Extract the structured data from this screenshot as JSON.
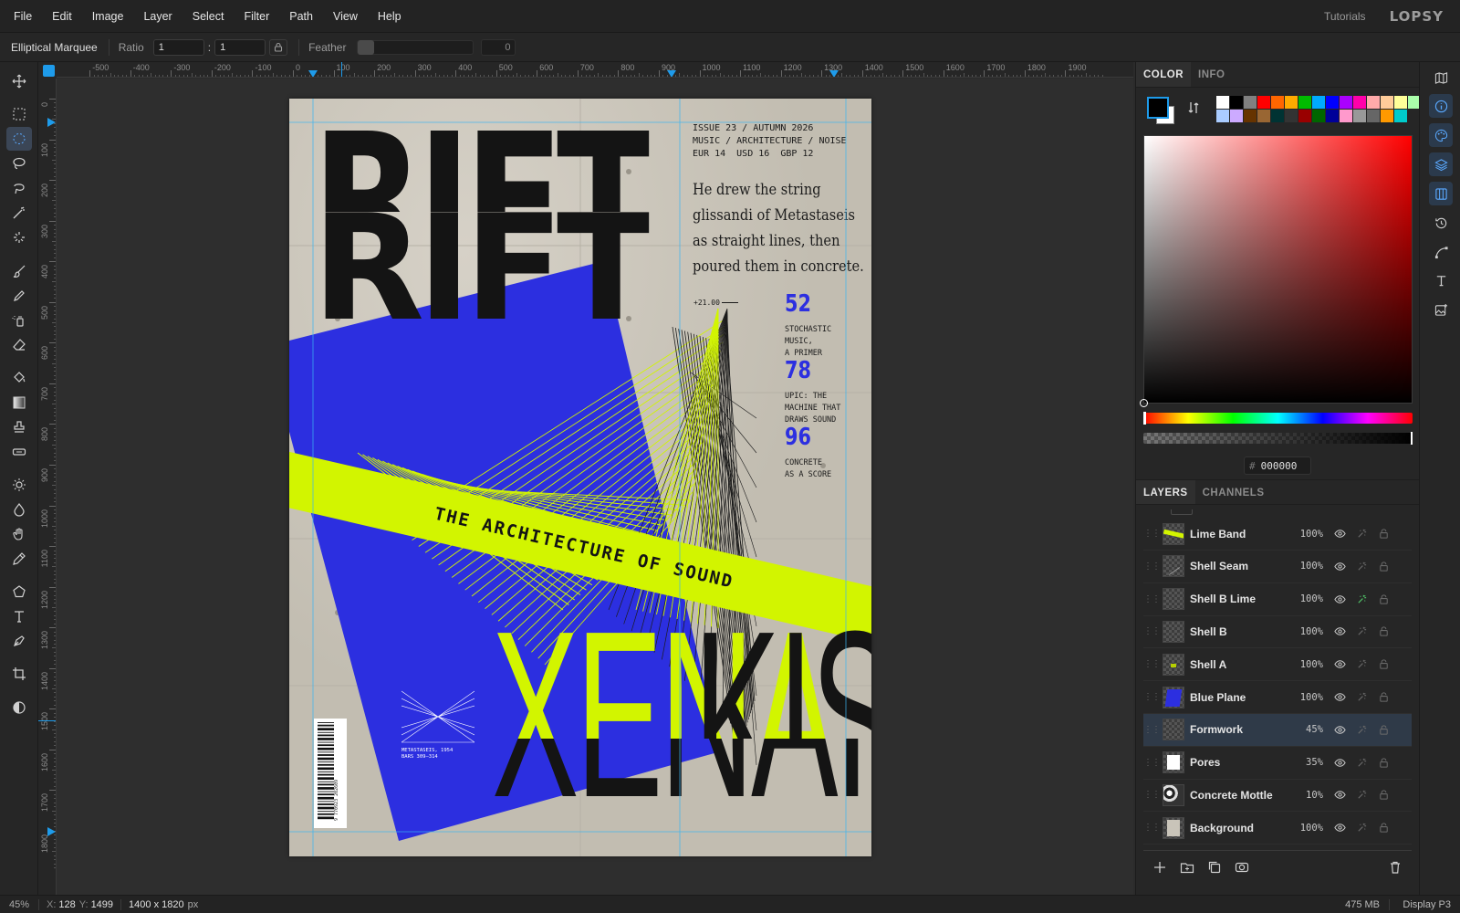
{
  "menu": [
    "File",
    "Edit",
    "Image",
    "Layer",
    "Select",
    "Filter",
    "Path",
    "View",
    "Help"
  ],
  "header": {
    "tutorials": "Tutorials",
    "logo": "LOPSY"
  },
  "options": {
    "tool_name": "Elliptical Marquee",
    "ratio_label": "Ratio",
    "ratio_w": "1",
    "ratio_sep": ":",
    "ratio_h": "1",
    "feather_label": "Feather",
    "feather_value": "0"
  },
  "ruler_top": [
    "-500",
    "-400",
    "-300",
    "-200",
    "-100",
    "0",
    "100",
    "200",
    "300",
    "400",
    "500",
    "600",
    "700",
    "800",
    "900",
    "1000",
    "1100",
    "1200",
    "1300",
    "1400",
    "1500",
    "1600",
    "1700",
    "1800",
    "1900"
  ],
  "ruler_left": [
    "0",
    "100",
    "200",
    "300",
    "400",
    "500",
    "600",
    "700",
    "800",
    "900",
    "1000",
    "1100",
    "1200",
    "1300",
    "1400",
    "1500",
    "1600",
    "1700",
    "1800"
  ],
  "tools": [
    "move-tool",
    "rect-marquee-tool",
    "elliptical-marquee-tool",
    "lasso-tool",
    "magnetic-lasso-tool",
    "magic-wand-tool",
    "quick-select-tool",
    "brush-tool",
    "pencil-tool",
    "spray-tool",
    "eraser-tool",
    "paint-bucket-tool",
    "gradient-tool",
    "clone-stamp-tool",
    "healing-tool",
    "dodge-tool",
    "burn-tool",
    "hand-tool",
    "eyedropper-tool",
    "shape-tool",
    "type-tool",
    "pen-tool",
    "crop-tool",
    "mask-mode-tool"
  ],
  "active_tool": "elliptical-marquee-tool",
  "artwork": {
    "issue_line1": "ISSUE 23 / AUTUMN 2026",
    "issue_line2": "MUSIC / ARCHITECTURE / NOISE",
    "issue_line3": "EUR 14  USD 16  GBP 12",
    "title_top": "RIFT",
    "title_bottom": "RIFT",
    "quote_l1": "He drew the string",
    "quote_l2": "glissandi of Metastaseis",
    "quote_l3": "as straight lines, then",
    "quote_l4": "poured them in concrete.",
    "coord_note": "+21.00",
    "contents": [
      {
        "page": "52",
        "line1": "STOCHASTIC",
        "line2": "MUSIC,",
        "line3": "A PRIMER"
      },
      {
        "page": "78",
        "line1": "UPIC: THE",
        "line2": "MACHINE THAT",
        "line3": "DRAWS SOUND"
      },
      {
        "page": "96",
        "line1": "CONCRETE",
        "line2": "AS A SCORE",
        "line3": ""
      }
    ],
    "band_text": "THE ARCHITECTURE OF SOUND",
    "name_lime": "XENA",
    "name_dark": "KIS",
    "name_shadow": "XENAKIS",
    "caption_l1": "METASTASEIS, 1954",
    "caption_l2": "BARS 309–314",
    "barcode": "9 770923 202609"
  },
  "colors": {
    "accent": "#1e9bea",
    "blue_plane": "#2c2fe0",
    "lime": "#d2f500",
    "concrete": "#c9c4b9",
    "ink": "#141414",
    "foreground": "#000000",
    "background": "#ffffff"
  },
  "color_panel": {
    "tabs": [
      "COLOR",
      "INFO"
    ],
    "hex_label": "#",
    "hex_value": "000000",
    "palette_row1": [
      "#ffffff",
      "#000000",
      "#808080",
      "#ff0000",
      "#ff6600",
      "#ffaa00",
      "#00bb00",
      "#00aaff",
      "#0000ff",
      "#aa00ff",
      "#ff00aa",
      "#ffaaaa",
      "#ffcc99",
      "#ffff99",
      "#aaffaa"
    ],
    "palette_row2": [
      "#aaccff",
      "#ccaaff",
      "#663300",
      "#996633",
      "#003333",
      "#333333",
      "#990000",
      "#006600",
      "#000099",
      "#ff99cc",
      "#999999",
      "#666666",
      "#ff9900",
      "#00cccc"
    ]
  },
  "layers_panel": {
    "tabs": [
      "LAYERS",
      "CHANNELS"
    ],
    "layers": [
      {
        "name": "Lime Band",
        "opacity": "100%",
        "fx_on": false
      },
      {
        "name": "Shell Seam",
        "opacity": "100%",
        "fx_on": false
      },
      {
        "name": "Shell B Lime",
        "opacity": "100%",
        "fx_on": true
      },
      {
        "name": "Shell B",
        "opacity": "100%",
        "fx_on": false
      },
      {
        "name": "Shell A",
        "opacity": "100%",
        "fx_on": false
      },
      {
        "name": "Blue Plane",
        "opacity": "100%",
        "fx_on": false
      },
      {
        "name": "Formwork",
        "opacity": "45%",
        "fx_on": false
      },
      {
        "name": "Pores",
        "opacity": "35%",
        "fx_on": false
      },
      {
        "name": "Concrete Mottle",
        "opacity": "10%",
        "fx_on": false
      },
      {
        "name": "Background",
        "opacity": "100%",
        "fx_on": false
      }
    ],
    "selected": "Formwork"
  },
  "side_icons": [
    "map-icon",
    "info-icon",
    "palette-icon",
    "layers-icon",
    "columns-icon",
    "history-icon",
    "curve-icon",
    "type-icon",
    "image-add-icon"
  ],
  "status": {
    "zoom": "45%",
    "x_label": "X:",
    "x_value": "128",
    "y_label": "Y:",
    "y_value": "1499",
    "doc_size": "1400 x 1820",
    "doc_unit": "px",
    "memory": "475 MB",
    "color_profile": "Display P3"
  }
}
